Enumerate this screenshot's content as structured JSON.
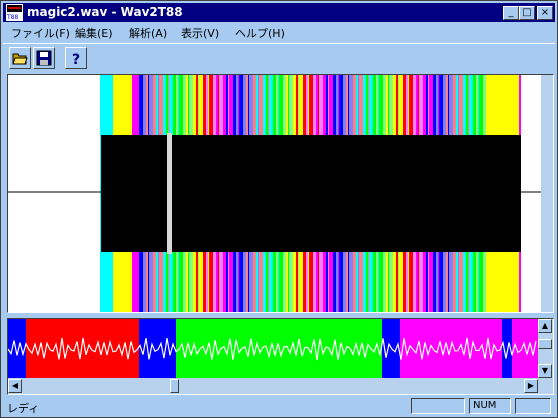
{
  "window": {
    "title": "magic2.wav - Wav2T88",
    "app_icon": "t88-app-icon"
  },
  "title_buttons": {
    "minimize": "_",
    "maximize": "□",
    "close": "×"
  },
  "menu": [
    {
      "label": "ファイル(F)"
    },
    {
      "label": "編集(E)"
    },
    {
      "label": "解析(A)"
    },
    {
      "label": "表示(V)"
    },
    {
      "label": "ヘルプ(H)"
    }
  ],
  "toolbar": {
    "icons": [
      "open-folder-icon",
      "save-disk-icon",
      "help-question-icon"
    ],
    "help_glyph": "?"
  },
  "status": {
    "text": "レディ",
    "num_indicator": "NUM"
  },
  "colors": {
    "cyan": "#00ffff",
    "yellow": "#ffff00",
    "magenta": "#ff00ff",
    "red": "#ff0000",
    "blue": "#0000ff",
    "green": "#00ff00",
    "waveform": "#000000"
  },
  "scroll_glyphs": {
    "up": "▲",
    "down": "▼",
    "left": "◀",
    "right": "▶"
  }
}
